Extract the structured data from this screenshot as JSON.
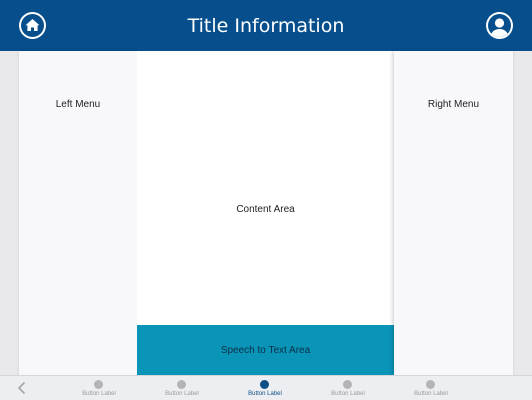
{
  "header": {
    "title": "Title Information",
    "home_icon": "home-icon",
    "profile_icon": "user-profile-icon"
  },
  "panels": {
    "left_menu": "Left Menu",
    "right_menu": "Right Menu",
    "content": "Content Area",
    "speech": "Speech to Text Area"
  },
  "bottom_nav": {
    "back_icon": "chevron-left-icon",
    "active_index": 2,
    "tabs": [
      {
        "label": "Button Label"
      },
      {
        "label": "Button Label"
      },
      {
        "label": "Button Label"
      },
      {
        "label": "Button Label"
      },
      {
        "label": "Button Label"
      }
    ]
  },
  "colors": {
    "header_bg": "#064e8c",
    "speech_bg": "#0a94b8",
    "active_tab": "#0e4f86",
    "inactive_tab": "#b4b4b8"
  }
}
